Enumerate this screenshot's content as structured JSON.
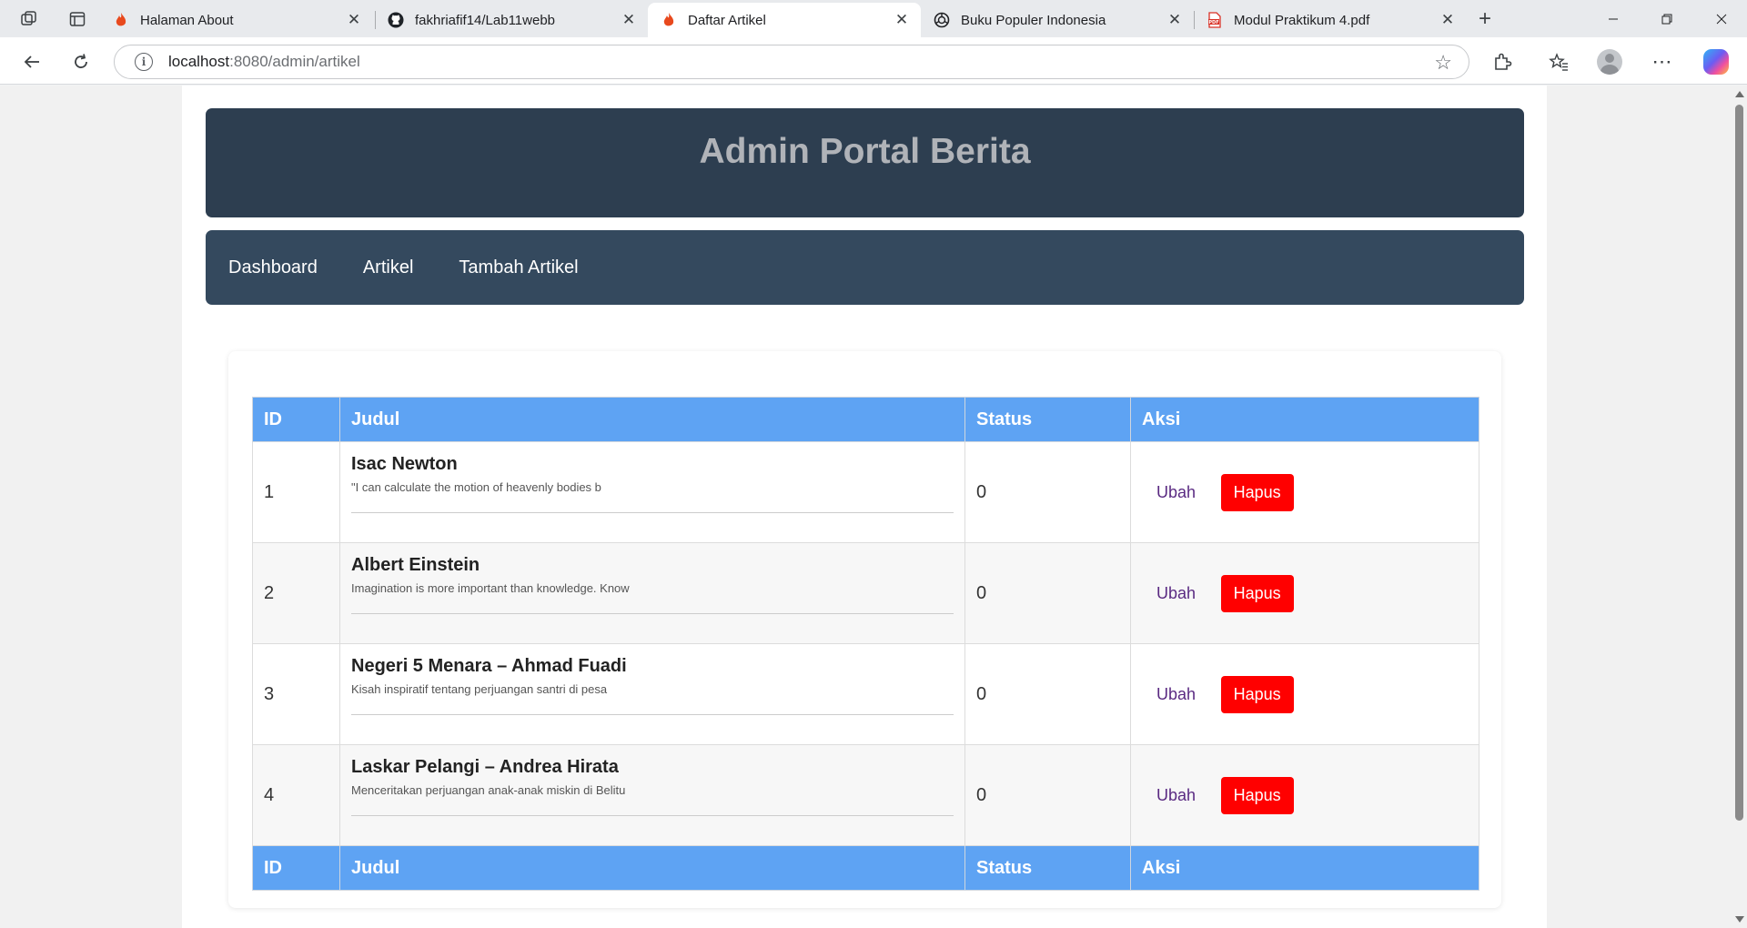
{
  "browser": {
    "tabs": [
      {
        "title": "Halaman About",
        "icon": "codeigniter-flame-icon",
        "active": false
      },
      {
        "title": "fakhriafif14/Lab11webb",
        "icon": "github-icon",
        "active": false
      },
      {
        "title": "Daftar Artikel",
        "icon": "codeigniter-flame-icon",
        "active": true
      },
      {
        "title": "Buku Populer Indonesia",
        "icon": "openai-icon",
        "active": false
      },
      {
        "title": "Modul Praktikum 4.pdf",
        "icon": "pdf-icon",
        "active": false
      }
    ],
    "url_host": "localhost",
    "url_path": ":8080/admin/artikel"
  },
  "page": {
    "site_title": "Admin Portal Berita",
    "nav": [
      "Dashboard",
      "Artikel",
      "Tambah Artikel"
    ],
    "table": {
      "headers": [
        "ID",
        "Judul",
        "Status",
        "Aksi"
      ],
      "rows": [
        {
          "id": "1",
          "title": "Isac Newton",
          "excerpt": "\"I can calculate the motion of heavenly bodies b",
          "status": "0"
        },
        {
          "id": "2",
          "title": "Albert Einstein",
          "excerpt": "Imagination is more important than knowledge. Know",
          "status": "0"
        },
        {
          "id": "3",
          "title": "Negeri 5 Menara – Ahmad Fuadi",
          "excerpt": "Kisah inspiratif tentang perjuangan santri di pesa",
          "status": "0"
        },
        {
          "id": "4",
          "title": "Laskar Pelangi – Andrea Hirata",
          "excerpt": "Menceritakan perjuangan anak-anak miskin di Belitu",
          "status": "0"
        }
      ],
      "edit_label": "Ubah",
      "delete_label": "Hapus",
      "delete_color": "#ff0000",
      "header_color": "#5ea3f3"
    }
  }
}
